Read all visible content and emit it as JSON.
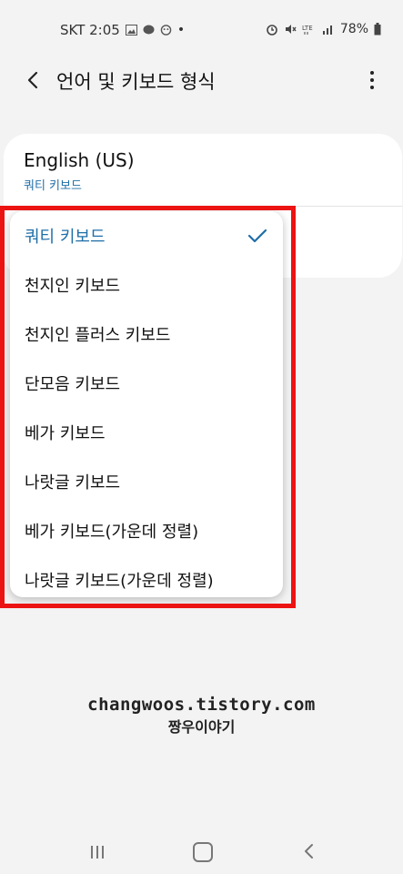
{
  "status_bar": {
    "carrier_time": "SKT 2:05",
    "dot": "•",
    "battery": "78%",
    "icons_left": [
      "image-icon",
      "chat-icon",
      "face-icon"
    ],
    "icons_right": [
      "alarm-icon",
      "mute-icon",
      "lte-icon",
      "signal-icon",
      "battery-icon"
    ]
  },
  "header": {
    "title": "언어 및 키보드 형식",
    "back_icon": "back-arrow-icon",
    "more_icon": "more-vert-icon"
  },
  "card": {
    "title": "English (US)",
    "subtitle": "쿼티 키보드"
  },
  "menu": {
    "items": [
      {
        "label": "쿼티 키보드",
        "selected": true
      },
      {
        "label": "천지인 키보드",
        "selected": false
      },
      {
        "label": "천지인 플러스 키보드",
        "selected": false
      },
      {
        "label": "단모음 키보드",
        "selected": false
      },
      {
        "label": "베가 키보드",
        "selected": false
      },
      {
        "label": "나랏글 키보드",
        "selected": false
      },
      {
        "label": "베가 키보드(가운데 정렬)",
        "selected": false
      },
      {
        "label": "나랏글 키보드(가운데 정렬)",
        "selected": false
      }
    ]
  },
  "watermark": {
    "line1": "changwoos.tistory.com",
    "line2": "짱우이야기"
  },
  "colors": {
    "accent": "#1f6ea8",
    "highlight": "#ec1313",
    "background": "#f3f3f3"
  }
}
